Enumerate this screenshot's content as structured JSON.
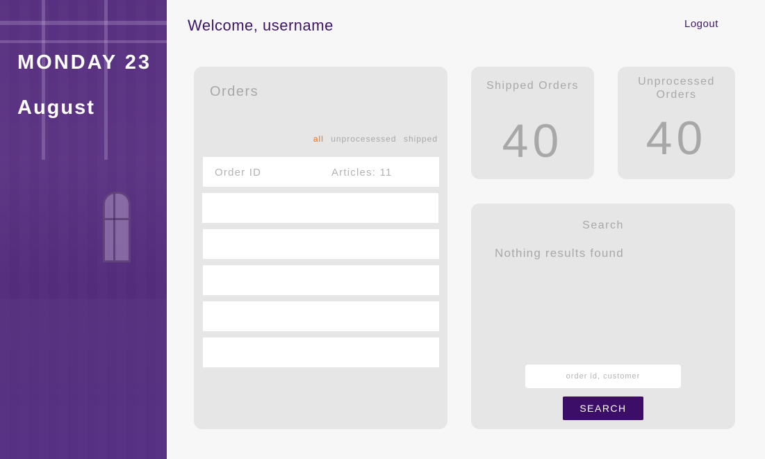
{
  "sidebar": {
    "day": "MONDAY 23",
    "month": "August"
  },
  "header": {
    "welcome": "Welcome, username",
    "logout_label": "Logout"
  },
  "orders": {
    "title": "Orders",
    "filters": [
      "all",
      "unprocesessed",
      "shipped"
    ],
    "active_filter": "all",
    "rows": [
      {
        "order_id": "Order ID",
        "articles": "Articles: 11"
      },
      {
        "order_id": "",
        "articles": ""
      },
      {
        "order_id": "",
        "articles": ""
      },
      {
        "order_id": "",
        "articles": ""
      },
      {
        "order_id": "",
        "articles": ""
      },
      {
        "order_id": "",
        "articles": ""
      }
    ]
  },
  "stats": {
    "shipped": {
      "title": "Shipped Orders",
      "value": "40"
    },
    "unprocessed": {
      "title": "Unprocessed Orders",
      "value": "40"
    }
  },
  "search": {
    "title": "Search",
    "result_text": "Nothing results found",
    "placeholder": "order id, customer",
    "button_label": "SEARCH"
  },
  "colors": {
    "brand_purple": "#3d0e68",
    "accent_orange": "#e8741c",
    "card_bg": "#e6e6e6"
  }
}
